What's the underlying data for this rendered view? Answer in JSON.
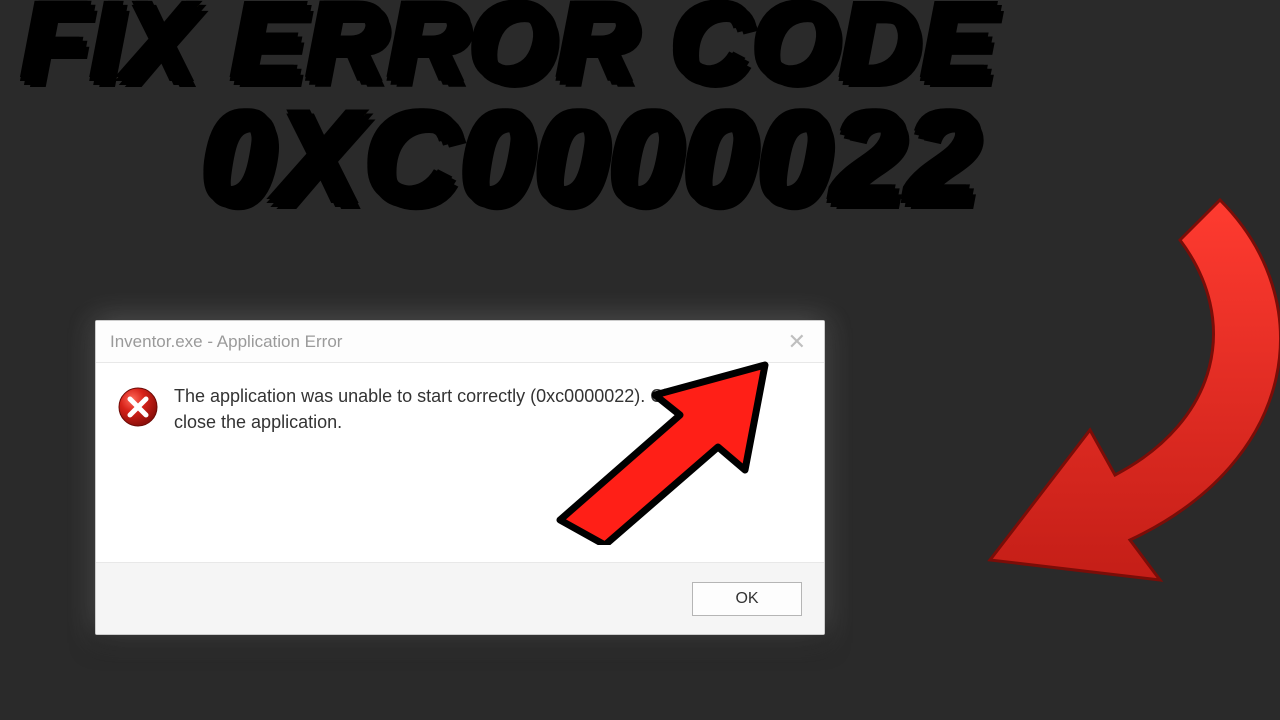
{
  "headline": {
    "line1": "FIX ERROR CODE",
    "line2": "0XC0000022"
  },
  "dialog": {
    "title": "Inventor.exe - Application Error",
    "message": "The application was unable to start correctly (0xc0000022). Click OK to close the application.",
    "ok_label": "OK"
  }
}
